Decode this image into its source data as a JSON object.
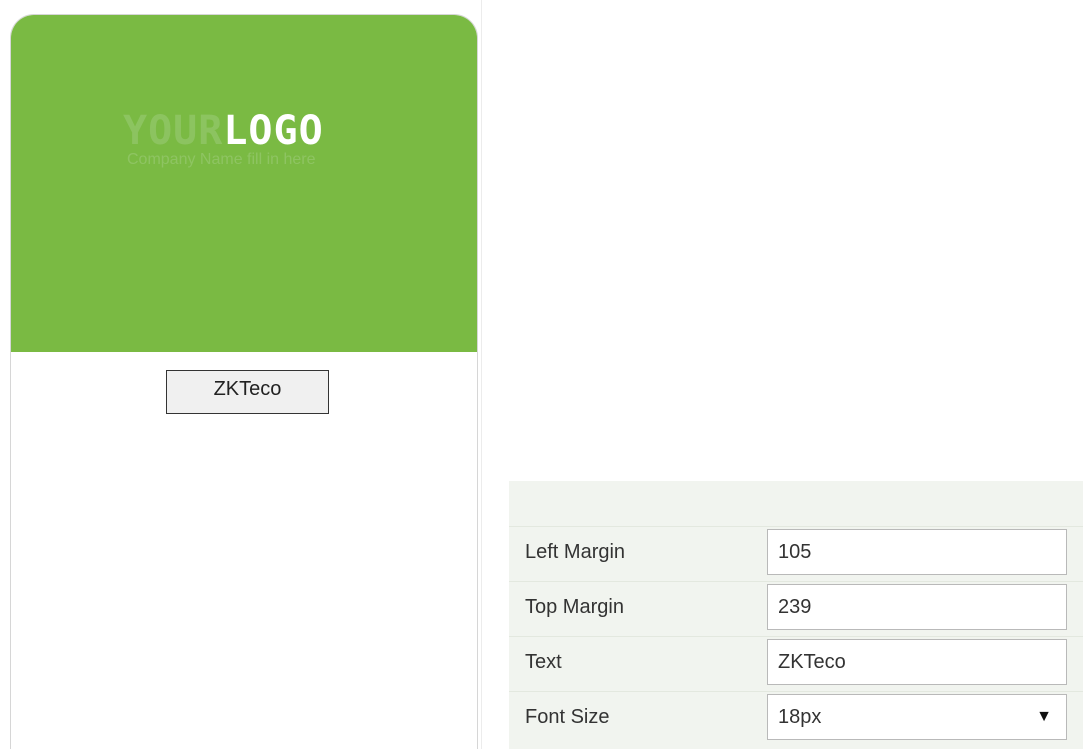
{
  "card": {
    "logo_your": "YOUR",
    "logo_logo": "LOGO",
    "logo_tagline": "Company Name fill in here",
    "text_element": "ZKTeco",
    "header_color": "#7aba43"
  },
  "properties": {
    "left_margin": {
      "label": "Left Margin",
      "value": "105"
    },
    "top_margin": {
      "label": "Top Margin",
      "value": "239"
    },
    "text": {
      "label": "Text",
      "value": "ZKTeco"
    },
    "font_size": {
      "label": "Font Size",
      "value": "18px",
      "arrow_icon": "dropdown-triangle-icon"
    }
  }
}
